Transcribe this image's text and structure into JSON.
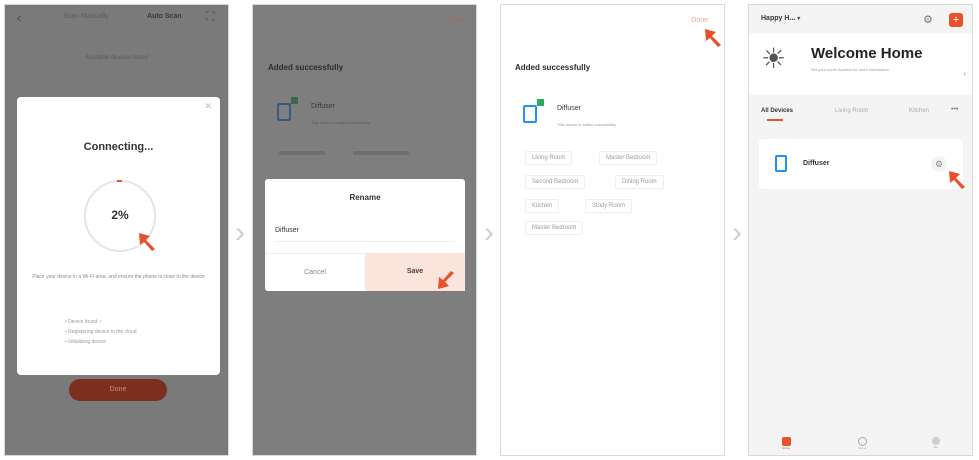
{
  "accent_color": "#e8512b",
  "panel1": {
    "header_left": "Scan Manually",
    "header_right": "Auto Scan",
    "subtitle": "Available devices found",
    "dialog_title": "Connecting...",
    "progress_label": "2%",
    "progress_value": 0.02,
    "status_text": "Place your device in a Wi-Fi area, and ensure the phone is close to the device",
    "steps": [
      "Device found",
      "Registering device to the cloud",
      "Initializing device"
    ],
    "done_button": "Done"
  },
  "panel2": {
    "header_right": "Done",
    "section_title": "Added successfully",
    "device_name": "Diffuser",
    "device_sub": "This device is added successfully",
    "dialog_title": "Rename",
    "input_value": "Diffuser",
    "cancel_label": "Cancel",
    "save_label": "Save"
  },
  "panel3": {
    "header_right": "Done",
    "section_title": "Added successfully",
    "device_name": "Diffuser",
    "device_sub": "This device is added successfully",
    "rooms": [
      "Living Room",
      "Master Bedroom",
      "Second Bedroom",
      "Dining Room",
      "Kitchen",
      "Study Room",
      "Master Bedroom"
    ]
  },
  "panel4": {
    "home_name": "Happy H...",
    "welcome_title": "Welcome Home",
    "welcome_sub": "Set your home location for more information",
    "tabs": [
      "All Devices",
      "Living Room",
      "Kitchen"
    ],
    "device_name": "Diffuser",
    "nav": [
      "Home",
      "Scene",
      "Me"
    ]
  },
  "icons": {
    "arrow": "red-pointer-arrow-icon",
    "separator": "chevron-right-icon",
    "gear": "gear-icon",
    "add": "plus-icon",
    "sun": "sun-icon"
  }
}
